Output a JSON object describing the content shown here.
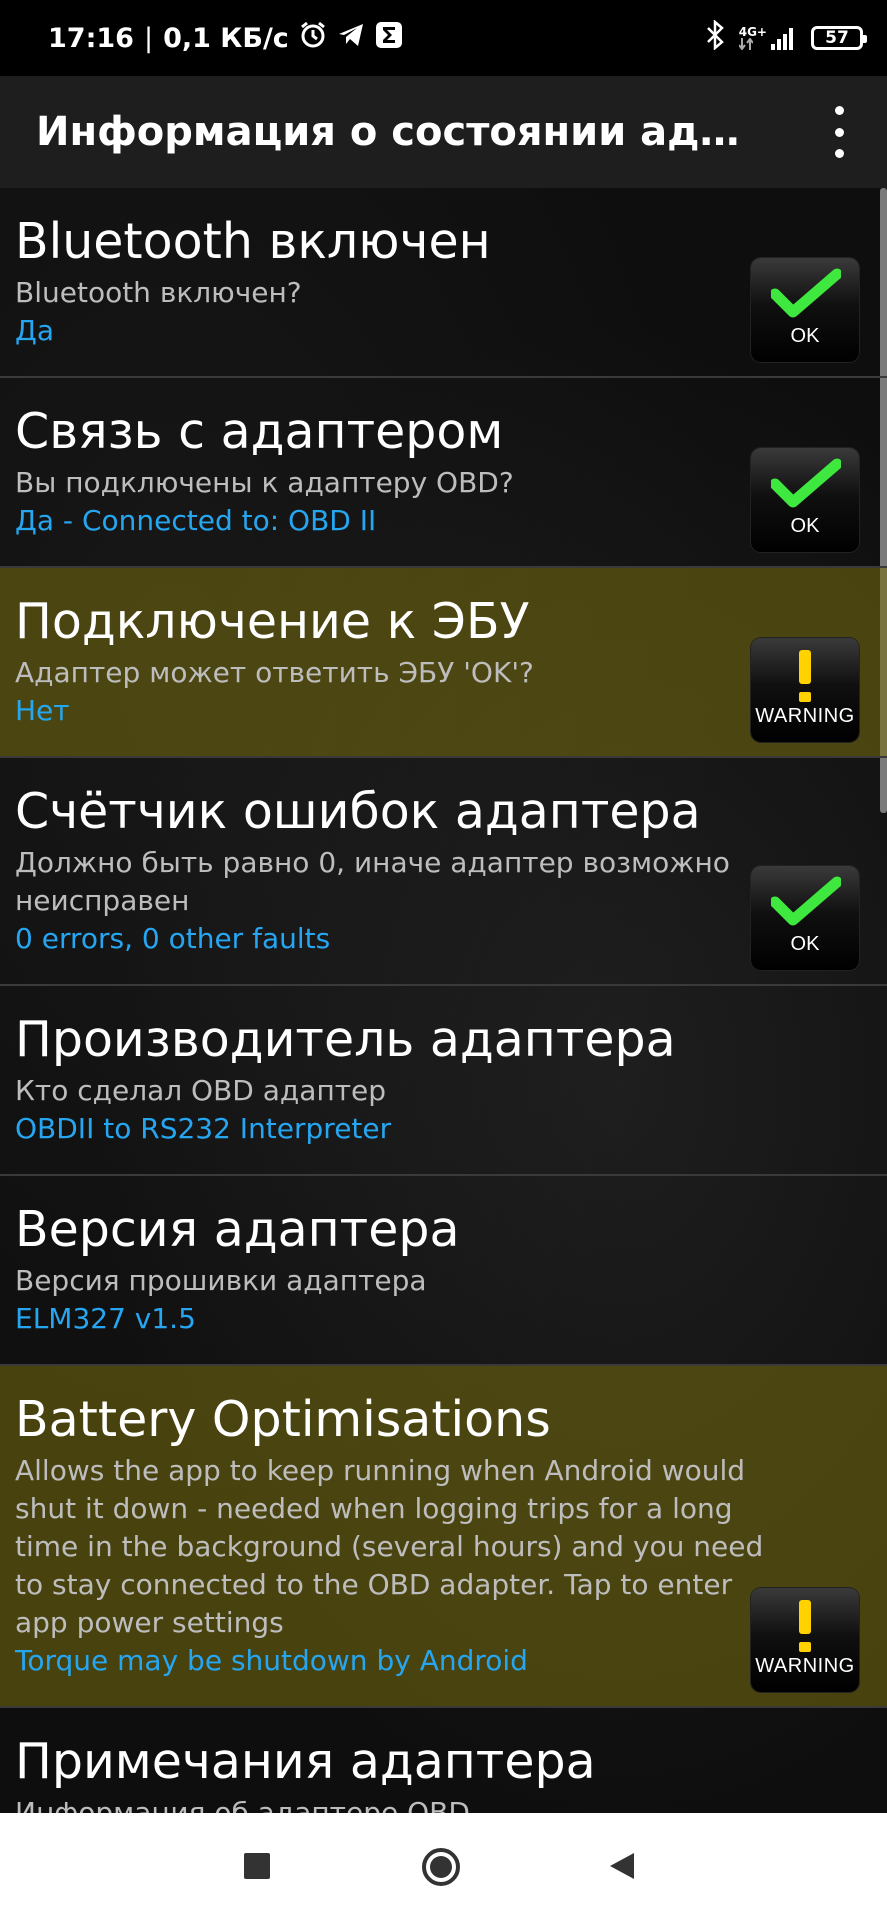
{
  "status_bar": {
    "time": "17:16",
    "speed": "0,1 КБ/с",
    "network_type": "4G+",
    "battery": "57"
  },
  "app_bar": {
    "title": "Информация о состоянии адаптера"
  },
  "items": [
    {
      "title": "Bluetooth включен",
      "description": "Bluetooth включен?",
      "value": "Да",
      "status": "ok",
      "status_label": "OK"
    },
    {
      "title": "Связь с адаптером",
      "description": "Вы подключены к адаптеру OBD?",
      "value": "Да - Connected to: OBD II",
      "status": "ok",
      "status_label": "OK"
    },
    {
      "title": "Подключение к ЭБУ",
      "description": "Адаптер может ответить ЭБУ 'OK'?",
      "value": "Нет",
      "status": "warning",
      "status_label": "WARNING"
    },
    {
      "title": "Счётчик ошибок адаптера",
      "description": "Должно быть равно 0, иначе адаптер возможно неисправен",
      "value": "0 errors, 0 other faults",
      "status": "ok",
      "status_label": "OK"
    },
    {
      "title": "Производитель адаптера",
      "description": "Кто сделал OBD адаптер",
      "value": "OBDII to RS232 Interpreter",
      "status": "none"
    },
    {
      "title": "Версия адаптера",
      "description": "Версия прошивки адаптера",
      "value": "ELM327 v1.5",
      "status": "none"
    },
    {
      "title": "Battery Optimisations",
      "description": "Allows the app to keep running when Android would shut it down - needed when logging trips for a long time in the background (several hours) and you need to stay connected to the OBD adapter. Tap to enter app power settings",
      "value": "Torque may be shutdown by Android",
      "status": "warning",
      "status_label": "WARNING"
    },
    {
      "title": "Примечания адаптера",
      "description": "Информация об адаптере OBD",
      "value": "",
      "status": "none"
    }
  ],
  "icons": {
    "ok": "check-icon",
    "warning": "exclamation-icon",
    "menu": "more-vert-icon",
    "nav_recents": "square-icon",
    "nav_home": "circle-icon",
    "nav_back": "triangle-back-icon"
  },
  "colors": {
    "value_text": "#26a6f0",
    "warning_row": "#6f6510",
    "check": "#3ee83e",
    "exclamation": "#ffd200"
  }
}
